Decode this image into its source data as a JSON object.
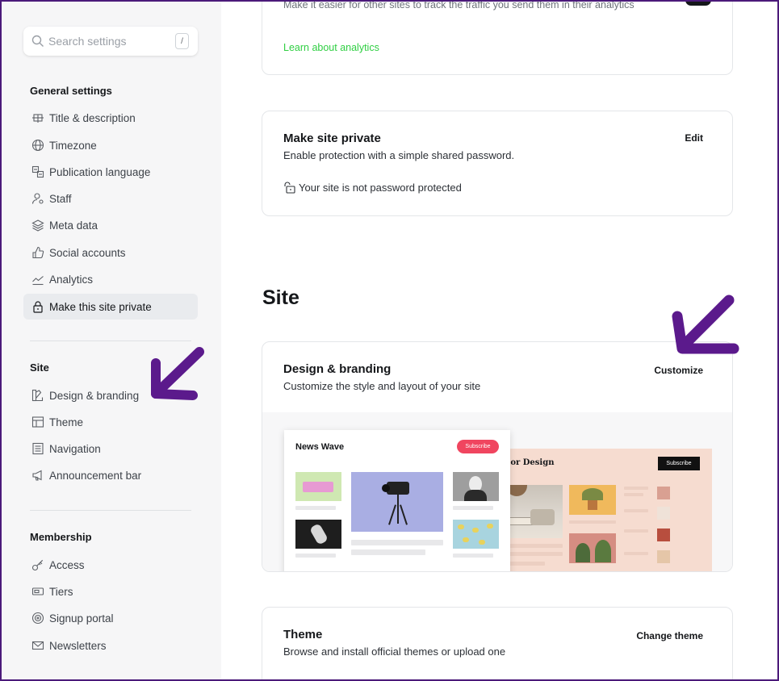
{
  "search": {
    "placeholder": "Search settings",
    "shortcut": "/"
  },
  "sidebar": {
    "general": {
      "title": "General settings",
      "items": [
        {
          "label": "Title & description",
          "icon": "title-description-icon"
        },
        {
          "label": "Timezone",
          "icon": "globe-icon"
        },
        {
          "label": "Publication language",
          "icon": "language-icon"
        },
        {
          "label": "Staff",
          "icon": "user-key-icon"
        },
        {
          "label": "Meta data",
          "icon": "layers-icon"
        },
        {
          "label": "Social accounts",
          "icon": "thumbs-up-icon"
        },
        {
          "label": "Analytics",
          "icon": "line-chart-icon"
        },
        {
          "label": "Make this site private",
          "icon": "lock-icon"
        }
      ]
    },
    "site": {
      "title": "Site",
      "items": [
        {
          "label": "Design & branding",
          "icon": "paint-brush-icon"
        },
        {
          "label": "Theme",
          "icon": "layout-icon"
        },
        {
          "label": "Navigation",
          "icon": "menu-list-icon"
        },
        {
          "label": "Announcement bar",
          "icon": "megaphone-icon"
        }
      ]
    },
    "membership": {
      "title": "Membership",
      "items": [
        {
          "label": "Access",
          "icon": "key-icon"
        },
        {
          "label": "Tiers",
          "icon": "ticket-icon"
        },
        {
          "label": "Signup portal",
          "icon": "portal-icon"
        },
        {
          "label": "Newsletters",
          "icon": "mail-icon"
        }
      ]
    }
  },
  "main": {
    "analytics_card": {
      "partial_text": "Make it easier for other sites to track the traffic you send them in their analytics",
      "link": "Learn about analytics"
    },
    "private_card": {
      "title": "Make site private",
      "description": "Enable protection with a simple shared password.",
      "action": "Edit",
      "status": "Your site is not password protected"
    },
    "site_section_title": "Site",
    "design_card": {
      "title": "Design & branding",
      "description": "Customize the style and layout of your site",
      "action": "Customize",
      "preview": {
        "front_title": "News Wave",
        "front_button": "Subscribe",
        "back_title": "nterior Design",
        "back_button": "Subscribe"
      }
    },
    "theme_card": {
      "title": "Theme",
      "description": "Browse and install official themes or upload one",
      "action": "Change theme"
    }
  },
  "colors": {
    "accent_green": "#30cf43",
    "annotation_arrow": "#5b1a8c",
    "subscribe_red": "#f0455f",
    "sidebar_bg": "#f6f6f7"
  }
}
